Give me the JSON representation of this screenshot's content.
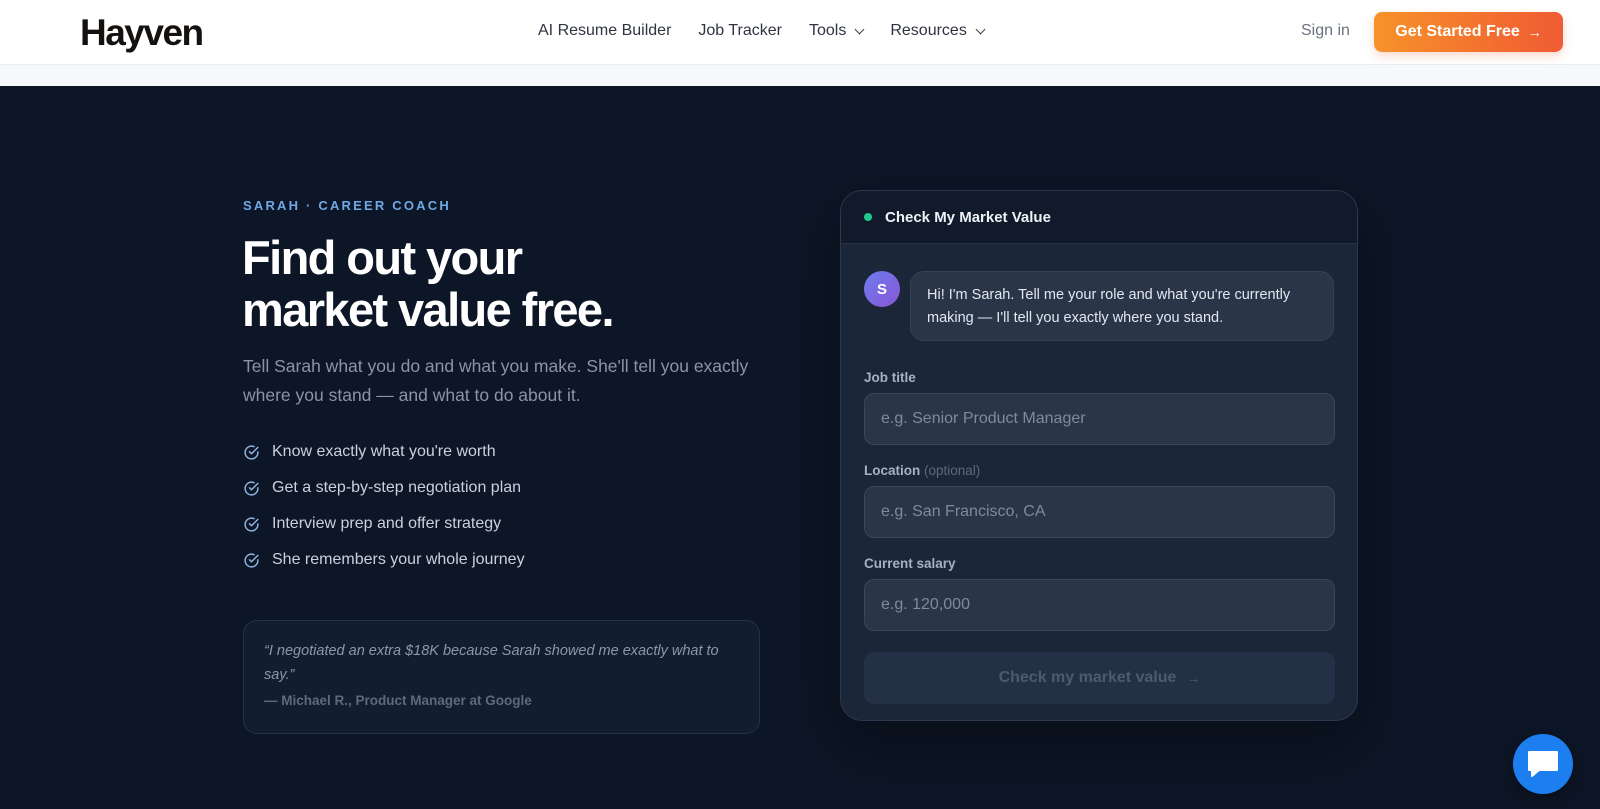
{
  "header": {
    "logo": "Hayven",
    "nav": [
      {
        "label": "AI Resume Builder",
        "dropdown": false
      },
      {
        "label": "Job Tracker",
        "dropdown": false
      },
      {
        "label": "Tools",
        "dropdown": true
      },
      {
        "label": "Resources",
        "dropdown": true
      }
    ],
    "sign_in": "Sign in",
    "cta": "Get Started Free"
  },
  "hero": {
    "eyebrow": "SARAH · CAREER COACH",
    "title_line1": "Find out your",
    "title_line2": "market value free.",
    "subtitle": "Tell Sarah what you do and what you make. She'll tell you exactly where you stand — and what to do about it.",
    "features": [
      "Know exactly what you're worth",
      "Get a step-by-step negotiation plan",
      "Interview prep and offer strategy",
      "She remembers your whole journey"
    ],
    "testimonial": {
      "quote": "“I negotiated an extra $18K because Sarah showed me exactly what to say.”",
      "author": "— Michael R., Product Manager at Google"
    }
  },
  "card": {
    "title": "Check My Market Value",
    "avatar_initial": "S",
    "message": "Hi! I'm Sarah. Tell me your role and what you're currently making — I'll tell you exactly where you stand.",
    "fields": {
      "job_title": {
        "label": "Job title",
        "placeholder": "e.g. Senior Product Manager",
        "value": ""
      },
      "location": {
        "label": "Location",
        "optional": "(optional)",
        "placeholder": "e.g. San Francisco, CA",
        "value": ""
      },
      "salary": {
        "label": "Current salary",
        "placeholder": "e.g. 120,000",
        "value": ""
      }
    },
    "submit": "Check my market value"
  },
  "colors": {
    "accent_start": "#f7922a",
    "accent_end": "#f05b33",
    "hero_bg": "#0d1626",
    "eyebrow": "#6ea8e6",
    "status_dot": "#22c98e",
    "chat_fab": "#1d7ef0"
  },
  "icons": {
    "feature": "check-circle-icon",
    "arrow": "arrow-right-icon",
    "dropdown": "chevron-down-icon",
    "chat_widget": "chat-bubble-icon"
  }
}
